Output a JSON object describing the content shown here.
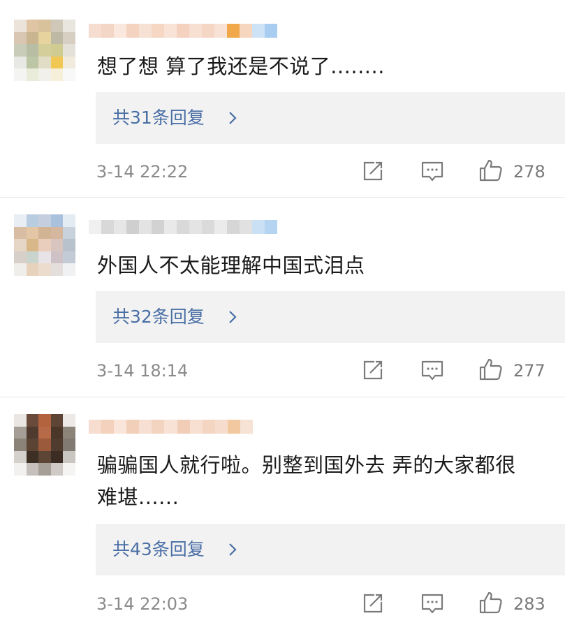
{
  "comments": [
    {
      "text": "想了想 算了我还是不说了........",
      "reply_label": "共31条回复",
      "time": "3-14 22:22",
      "likes": "278"
    },
    {
      "text": "外国人不太能理解中国式泪点",
      "reply_label": "共32条回复",
      "time": "3-14 18:14",
      "likes": "277"
    },
    {
      "text": "骗骗国人就行啦。别整到国外去 弄的大家都很难堪......",
      "reply_label": "共43条回复",
      "time": "3-14 22:03",
      "likes": "283"
    }
  ],
  "icons": {
    "reply_arrow": "chevron-right-icon",
    "share": "share-edit-icon",
    "comment": "comment-icon",
    "like": "thumbs-up-icon"
  },
  "colors": {
    "link": "#4a6fa5",
    "reply_bg": "#f2f2f2",
    "meta": "#8a8a8a"
  }
}
